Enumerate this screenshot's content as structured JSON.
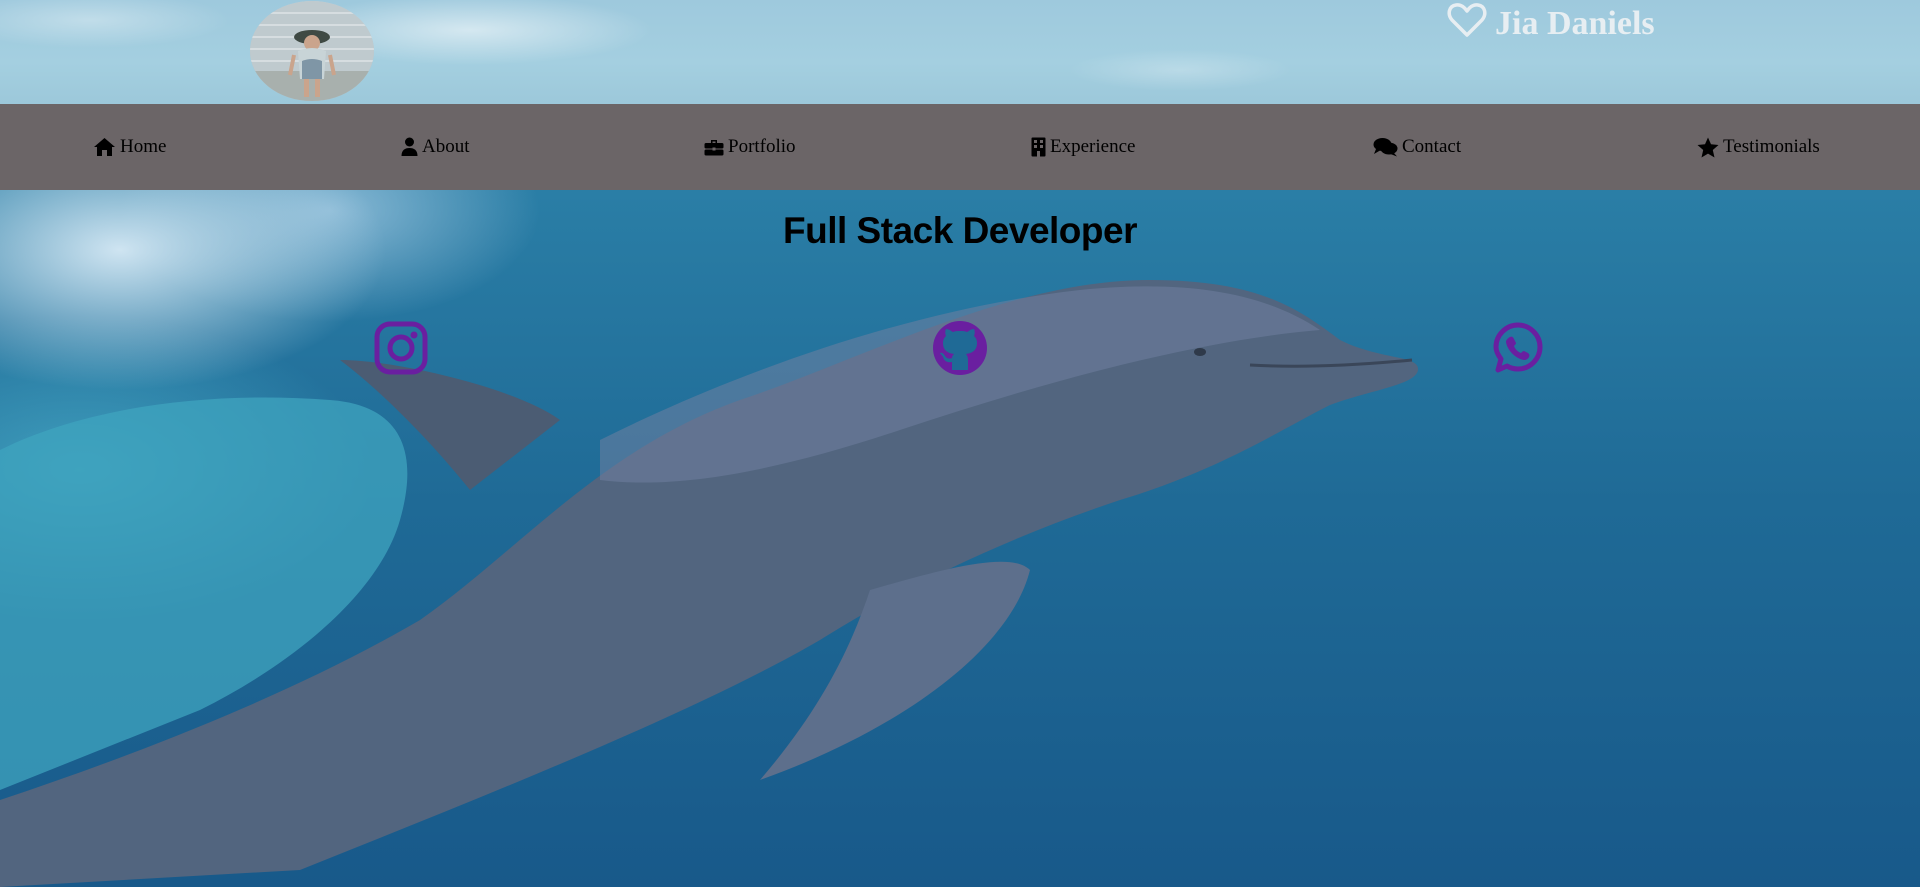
{
  "header": {
    "avatar_alt": "profile photo",
    "brand_name": "Jia Daniels",
    "brand_icon": "heart-outline-icon"
  },
  "nav": {
    "items": [
      {
        "label": "Home",
        "icon": "house-icon"
      },
      {
        "label": "About",
        "icon": "user-icon"
      },
      {
        "label": "Portfolio",
        "icon": "briefcase-icon"
      },
      {
        "label": "Experience",
        "icon": "building-icon"
      },
      {
        "label": "Contact",
        "icon": "comments-icon"
      },
      {
        "label": "Testimonials",
        "icon": "star-icon"
      }
    ]
  },
  "hero": {
    "title": "Full Stack Developer",
    "social_links": [
      {
        "name": "Instagram",
        "icon": "instagram-icon"
      },
      {
        "name": "GitHub",
        "icon": "github-icon"
      },
      {
        "name": "WhatsApp",
        "icon": "whatsapp-icon"
      }
    ]
  },
  "colors": {
    "nav_background": "#6b6567",
    "social_icon": "#6a1fa0",
    "brand_text": "#e7eef2"
  }
}
